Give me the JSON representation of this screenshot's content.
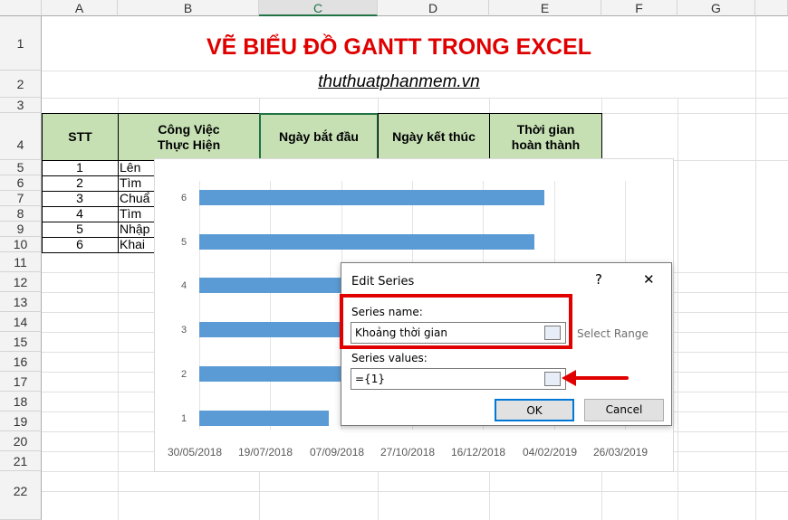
{
  "columns": [
    "A",
    "B",
    "C",
    "D",
    "E",
    "F",
    "G"
  ],
  "rows": [
    "1",
    "2",
    "3",
    "4",
    "5",
    "6",
    "7",
    "8",
    "9",
    "10",
    "11",
    "12",
    "13",
    "14",
    "15",
    "16",
    "17",
    "18",
    "19",
    "20",
    "21",
    "22"
  ],
  "title": "VẼ BIỂU ĐỒ GANTT TRONG EXCEL",
  "subtitle": "thuthuatphanmem.vn",
  "table": {
    "headers": {
      "stt": "STT",
      "task_1": "Công Việc",
      "task_2": "Thực Hiện",
      "start": "Ngày bắt đầu",
      "end": "Ngày kết thúc",
      "dur_1": "Thời gian",
      "dur_2": "hoàn thành"
    },
    "stt": [
      "1",
      "2",
      "3",
      "4",
      "5",
      "6"
    ],
    "tasks": [
      "Lên",
      "Tìm",
      "Chuẩ",
      "Tìm",
      "Nhập",
      "Khai"
    ]
  },
  "chart_data": {
    "type": "bar",
    "orientation": "horizontal",
    "categories": [
      "1",
      "2",
      "3",
      "4",
      "5",
      "6"
    ],
    "x_ticks": [
      "30/05/2018",
      "19/07/2018",
      "07/09/2018",
      "27/10/2018",
      "16/12/2018",
      "04/02/2019",
      "26/03/2019"
    ],
    "series": [
      {
        "values": [
          "2018-08-29",
          "2019-01-22",
          "2019-01-21",
          "2019-01-22",
          "2019-01-21",
          "2019-01-28"
        ]
      }
    ],
    "xlim": [
      "2018-05-30",
      "2019-03-26"
    ],
    "colors": [
      "#5b9bd5"
    ]
  },
  "dialog": {
    "title": "Edit Series",
    "help": "?",
    "close": "✕",
    "series_name_label": "Series name:",
    "series_name_value": "Khoảng thời gian",
    "select_range": "Select Range",
    "series_values_label": "Series values:",
    "series_values_value": "={1}",
    "ok": "OK",
    "cancel": "Cancel"
  },
  "colors": {
    "accent": "#e00000",
    "header_fill": "#c6e0b4",
    "bar": "#5b9bd5",
    "highlight_box": "#e00000"
  }
}
